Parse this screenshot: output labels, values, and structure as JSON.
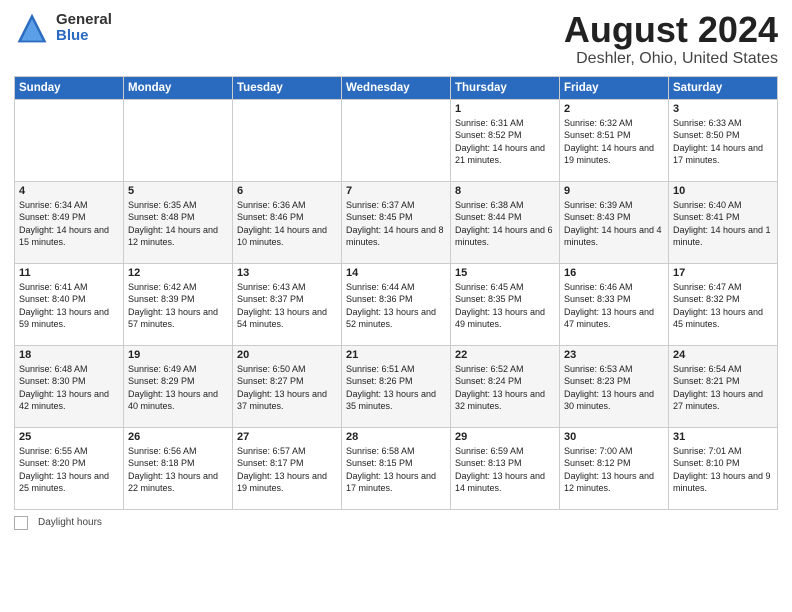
{
  "logo": {
    "general": "General",
    "blue": "Blue"
  },
  "header": {
    "month": "August 2024",
    "location": "Deshler, Ohio, United States"
  },
  "days_of_week": [
    "Sunday",
    "Monday",
    "Tuesday",
    "Wednesday",
    "Thursday",
    "Friday",
    "Saturday"
  ],
  "weeks": [
    [
      {
        "day": "",
        "info": ""
      },
      {
        "day": "",
        "info": ""
      },
      {
        "day": "",
        "info": ""
      },
      {
        "day": "",
        "info": ""
      },
      {
        "day": "1",
        "info": "Sunrise: 6:31 AM\nSunset: 8:52 PM\nDaylight: 14 hours and 21 minutes."
      },
      {
        "day": "2",
        "info": "Sunrise: 6:32 AM\nSunset: 8:51 PM\nDaylight: 14 hours and 19 minutes."
      },
      {
        "day": "3",
        "info": "Sunrise: 6:33 AM\nSunset: 8:50 PM\nDaylight: 14 hours and 17 minutes."
      }
    ],
    [
      {
        "day": "4",
        "info": "Sunrise: 6:34 AM\nSunset: 8:49 PM\nDaylight: 14 hours and 15 minutes."
      },
      {
        "day": "5",
        "info": "Sunrise: 6:35 AM\nSunset: 8:48 PM\nDaylight: 14 hours and 12 minutes."
      },
      {
        "day": "6",
        "info": "Sunrise: 6:36 AM\nSunset: 8:46 PM\nDaylight: 14 hours and 10 minutes."
      },
      {
        "day": "7",
        "info": "Sunrise: 6:37 AM\nSunset: 8:45 PM\nDaylight: 14 hours and 8 minutes."
      },
      {
        "day": "8",
        "info": "Sunrise: 6:38 AM\nSunset: 8:44 PM\nDaylight: 14 hours and 6 minutes."
      },
      {
        "day": "9",
        "info": "Sunrise: 6:39 AM\nSunset: 8:43 PM\nDaylight: 14 hours and 4 minutes."
      },
      {
        "day": "10",
        "info": "Sunrise: 6:40 AM\nSunset: 8:41 PM\nDaylight: 14 hours and 1 minute."
      }
    ],
    [
      {
        "day": "11",
        "info": "Sunrise: 6:41 AM\nSunset: 8:40 PM\nDaylight: 13 hours and 59 minutes."
      },
      {
        "day": "12",
        "info": "Sunrise: 6:42 AM\nSunset: 8:39 PM\nDaylight: 13 hours and 57 minutes."
      },
      {
        "day": "13",
        "info": "Sunrise: 6:43 AM\nSunset: 8:37 PM\nDaylight: 13 hours and 54 minutes."
      },
      {
        "day": "14",
        "info": "Sunrise: 6:44 AM\nSunset: 8:36 PM\nDaylight: 13 hours and 52 minutes."
      },
      {
        "day": "15",
        "info": "Sunrise: 6:45 AM\nSunset: 8:35 PM\nDaylight: 13 hours and 49 minutes."
      },
      {
        "day": "16",
        "info": "Sunrise: 6:46 AM\nSunset: 8:33 PM\nDaylight: 13 hours and 47 minutes."
      },
      {
        "day": "17",
        "info": "Sunrise: 6:47 AM\nSunset: 8:32 PM\nDaylight: 13 hours and 45 minutes."
      }
    ],
    [
      {
        "day": "18",
        "info": "Sunrise: 6:48 AM\nSunset: 8:30 PM\nDaylight: 13 hours and 42 minutes."
      },
      {
        "day": "19",
        "info": "Sunrise: 6:49 AM\nSunset: 8:29 PM\nDaylight: 13 hours and 40 minutes."
      },
      {
        "day": "20",
        "info": "Sunrise: 6:50 AM\nSunset: 8:27 PM\nDaylight: 13 hours and 37 minutes."
      },
      {
        "day": "21",
        "info": "Sunrise: 6:51 AM\nSunset: 8:26 PM\nDaylight: 13 hours and 35 minutes."
      },
      {
        "day": "22",
        "info": "Sunrise: 6:52 AM\nSunset: 8:24 PM\nDaylight: 13 hours and 32 minutes."
      },
      {
        "day": "23",
        "info": "Sunrise: 6:53 AM\nSunset: 8:23 PM\nDaylight: 13 hours and 30 minutes."
      },
      {
        "day": "24",
        "info": "Sunrise: 6:54 AM\nSunset: 8:21 PM\nDaylight: 13 hours and 27 minutes."
      }
    ],
    [
      {
        "day": "25",
        "info": "Sunrise: 6:55 AM\nSunset: 8:20 PM\nDaylight: 13 hours and 25 minutes."
      },
      {
        "day": "26",
        "info": "Sunrise: 6:56 AM\nSunset: 8:18 PM\nDaylight: 13 hours and 22 minutes."
      },
      {
        "day": "27",
        "info": "Sunrise: 6:57 AM\nSunset: 8:17 PM\nDaylight: 13 hours and 19 minutes."
      },
      {
        "day": "28",
        "info": "Sunrise: 6:58 AM\nSunset: 8:15 PM\nDaylight: 13 hours and 17 minutes."
      },
      {
        "day": "29",
        "info": "Sunrise: 6:59 AM\nSunset: 8:13 PM\nDaylight: 13 hours and 14 minutes."
      },
      {
        "day": "30",
        "info": "Sunrise: 7:00 AM\nSunset: 8:12 PM\nDaylight: 13 hours and 12 minutes."
      },
      {
        "day": "31",
        "info": "Sunrise: 7:01 AM\nSunset: 8:10 PM\nDaylight: 13 hours and 9 minutes."
      }
    ]
  ],
  "footer": {
    "label": "Daylight hours"
  }
}
